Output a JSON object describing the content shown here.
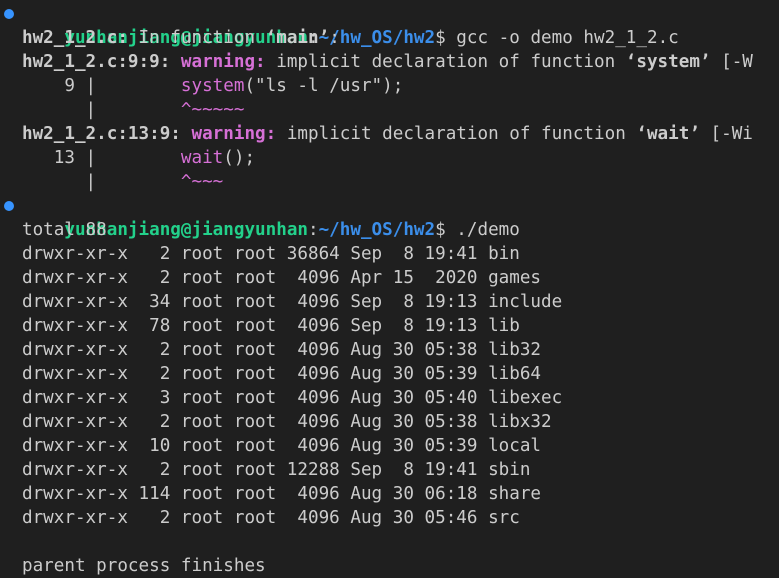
{
  "prompt1": {
    "user_host": "yunhanjiang@jiangyunhan",
    "colon": ":",
    "path": "~/hw_OS/hw2",
    "dollar": "$",
    "command": " gcc -o demo hw2_1_2.c"
  },
  "compile": {
    "line1_file": "hw2_1_2.c:",
    "line1_text": " In function ",
    "line1_fn": "‘main’",
    "line1_end": ":",
    "w1_loc": "hw2_1_2.c:9:9:",
    "w1_label": "warning:",
    "w1_text": " implicit declaration of function ",
    "w1_fn": "‘system’",
    "w1_flag": " [-W",
    "w1_gutter": "    9 |        ",
    "w1_code_hl": "system",
    "w1_code_rest": "(\"ls -l /usr\");",
    "w1_caret_gutter": "      |        ",
    "w1_caret": "^~~~~~",
    "w2_loc": "hw2_1_2.c:13:9:",
    "w2_label": "warning:",
    "w2_text": " implicit declaration of function ",
    "w2_fn": "‘wait’",
    "w2_flag": " [-Wi",
    "w2_gutter": "   13 |        ",
    "w2_code_hl": "wait",
    "w2_code_rest": "();",
    "w2_caret_gutter": "      |        ",
    "w2_caret": "^~~~"
  },
  "prompt2": {
    "user_host": "yunhanjiang@jiangyunhan",
    "colon": ":",
    "path": "~/hw_OS/hw2",
    "dollar": "$",
    "command": " ./demo"
  },
  "output": {
    "total": "total 88",
    "listing": [
      "drwxr-xr-x   2 root root 36864 Sep  8 19:41 bin",
      "drwxr-xr-x   2 root root  4096 Apr 15  2020 games",
      "drwxr-xr-x  34 root root  4096 Sep  8 19:13 include",
      "drwxr-xr-x  78 root root  4096 Sep  8 19:13 lib",
      "drwxr-xr-x   2 root root  4096 Aug 30 05:38 lib32",
      "drwxr-xr-x   2 root root  4096 Aug 30 05:39 lib64",
      "drwxr-xr-x   3 root root  4096 Aug 30 05:40 libexec",
      "drwxr-xr-x   2 root root  4096 Aug 30 05:38 libx32",
      "drwxr-xr-x  10 root root  4096 Aug 30 05:39 local",
      "drwxr-xr-x   2 root root 12288 Sep  8 19:41 sbin",
      "drwxr-xr-x 114 root root  4096 Aug 30 06:18 share",
      "drwxr-xr-x   2 root root  4096 Aug 30 05:46 src"
    ],
    "blank": "",
    "final": "parent process finishes"
  },
  "colors": {
    "background": "#1f1f1f",
    "foreground": "#cccccc",
    "prompt_user": "#23d18b",
    "prompt_path": "#3b8eea",
    "warning": "#d670d6",
    "decoration_dot": "#3794ff"
  },
  "icons": {
    "command_decoration": "command-success-dot"
  }
}
